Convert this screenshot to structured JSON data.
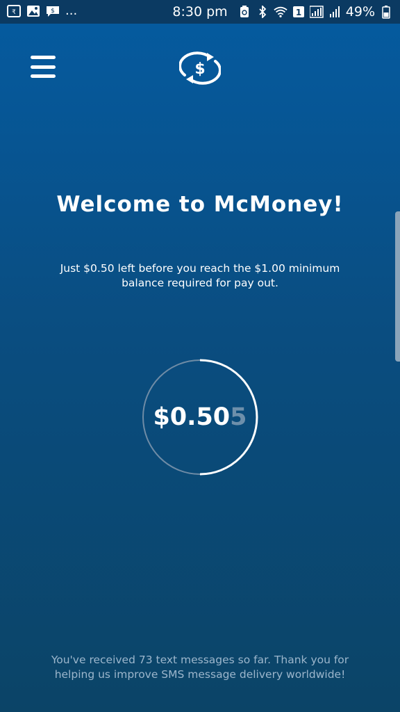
{
  "status_bar": {
    "left_icons": [
      "data-saver-icon",
      "image-icon",
      "sms-icon"
    ],
    "overflow": "...",
    "time": "8:30 pm",
    "right_icons": [
      "recycle-battery-icon",
      "bluetooth-icon",
      "wifi-icon",
      "sim-1-icon",
      "signal-bars-icon",
      "signal-bars-icon"
    ],
    "battery": "49%"
  },
  "header": {
    "menu_icon": "hamburger-menu-icon",
    "logo_icon": "dollar-exchange-icon"
  },
  "welcome": {
    "title": "Welcome to McMoney!",
    "subtitle": "Just $0.50 left before you reach the $1.00 minimum balance required for pay out."
  },
  "balance": {
    "main": "$0.50",
    "trailing_digit": "5",
    "progress": 0.5
  },
  "footer": {
    "message": "You've received 73 text messages so far. Thank you for helping us improve SMS message delivery worldwide!"
  }
}
